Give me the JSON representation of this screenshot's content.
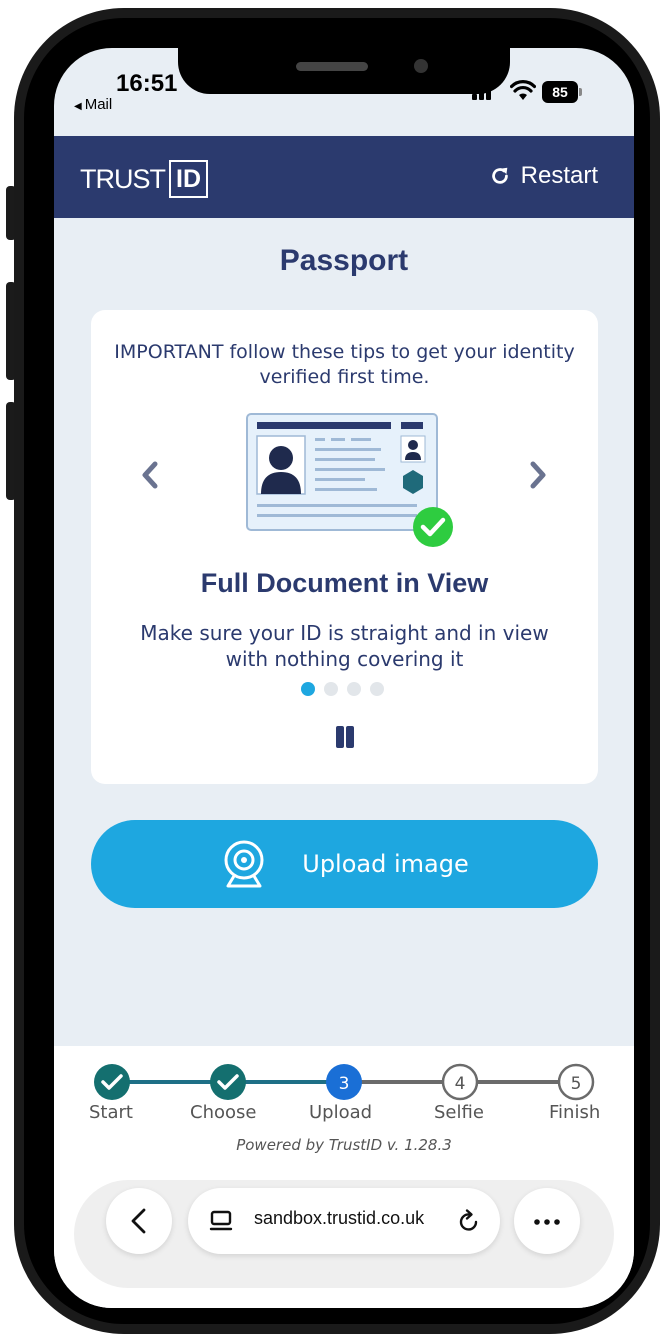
{
  "status_bar": {
    "time": "16:51",
    "back_app": "Mail",
    "battery": "85"
  },
  "header": {
    "logo_trust": "TRUST",
    "logo_id": "ID",
    "restart_label": "Restart"
  },
  "main": {
    "title": "Passport",
    "tips": {
      "intro": "IMPORTANT follow these tips to get your identity verified first time.",
      "heading": "Full Document in View",
      "text": "Make sure your ID is straight and in view with nothing covering it",
      "slide_count": 4,
      "active_slide": 1
    },
    "upload_label": "Upload image"
  },
  "progress": {
    "steps": [
      {
        "number": "1",
        "label": "Start",
        "state": "done"
      },
      {
        "number": "2",
        "label": "Choose",
        "state": "done"
      },
      {
        "number": "3",
        "label": "Upload",
        "state": "current"
      },
      {
        "number": "4",
        "label": "Selfie",
        "state": "todo"
      },
      {
        "number": "5",
        "label": "Finish",
        "state": "todo"
      }
    ],
    "powered_by": "Powered by TrustID v. 1.28.3"
  },
  "browser": {
    "url": "sandbox.trustid.co.uk"
  },
  "colors": {
    "brand_navy": "#2b3a6e",
    "accent_blue": "#1ea7e0",
    "step_done": "#146f6f",
    "check_green": "#2ecc40"
  },
  "icons": {
    "restart": "refresh-icon",
    "prev": "chevron-left-icon",
    "next": "chevron-right-icon",
    "pause": "pause-icon",
    "upload": "webcam-icon",
    "check": "check-icon",
    "nav_back": "chevron-left-icon",
    "tabs": "tabs-icon",
    "reload": "reload-icon",
    "more": "more-icon"
  }
}
